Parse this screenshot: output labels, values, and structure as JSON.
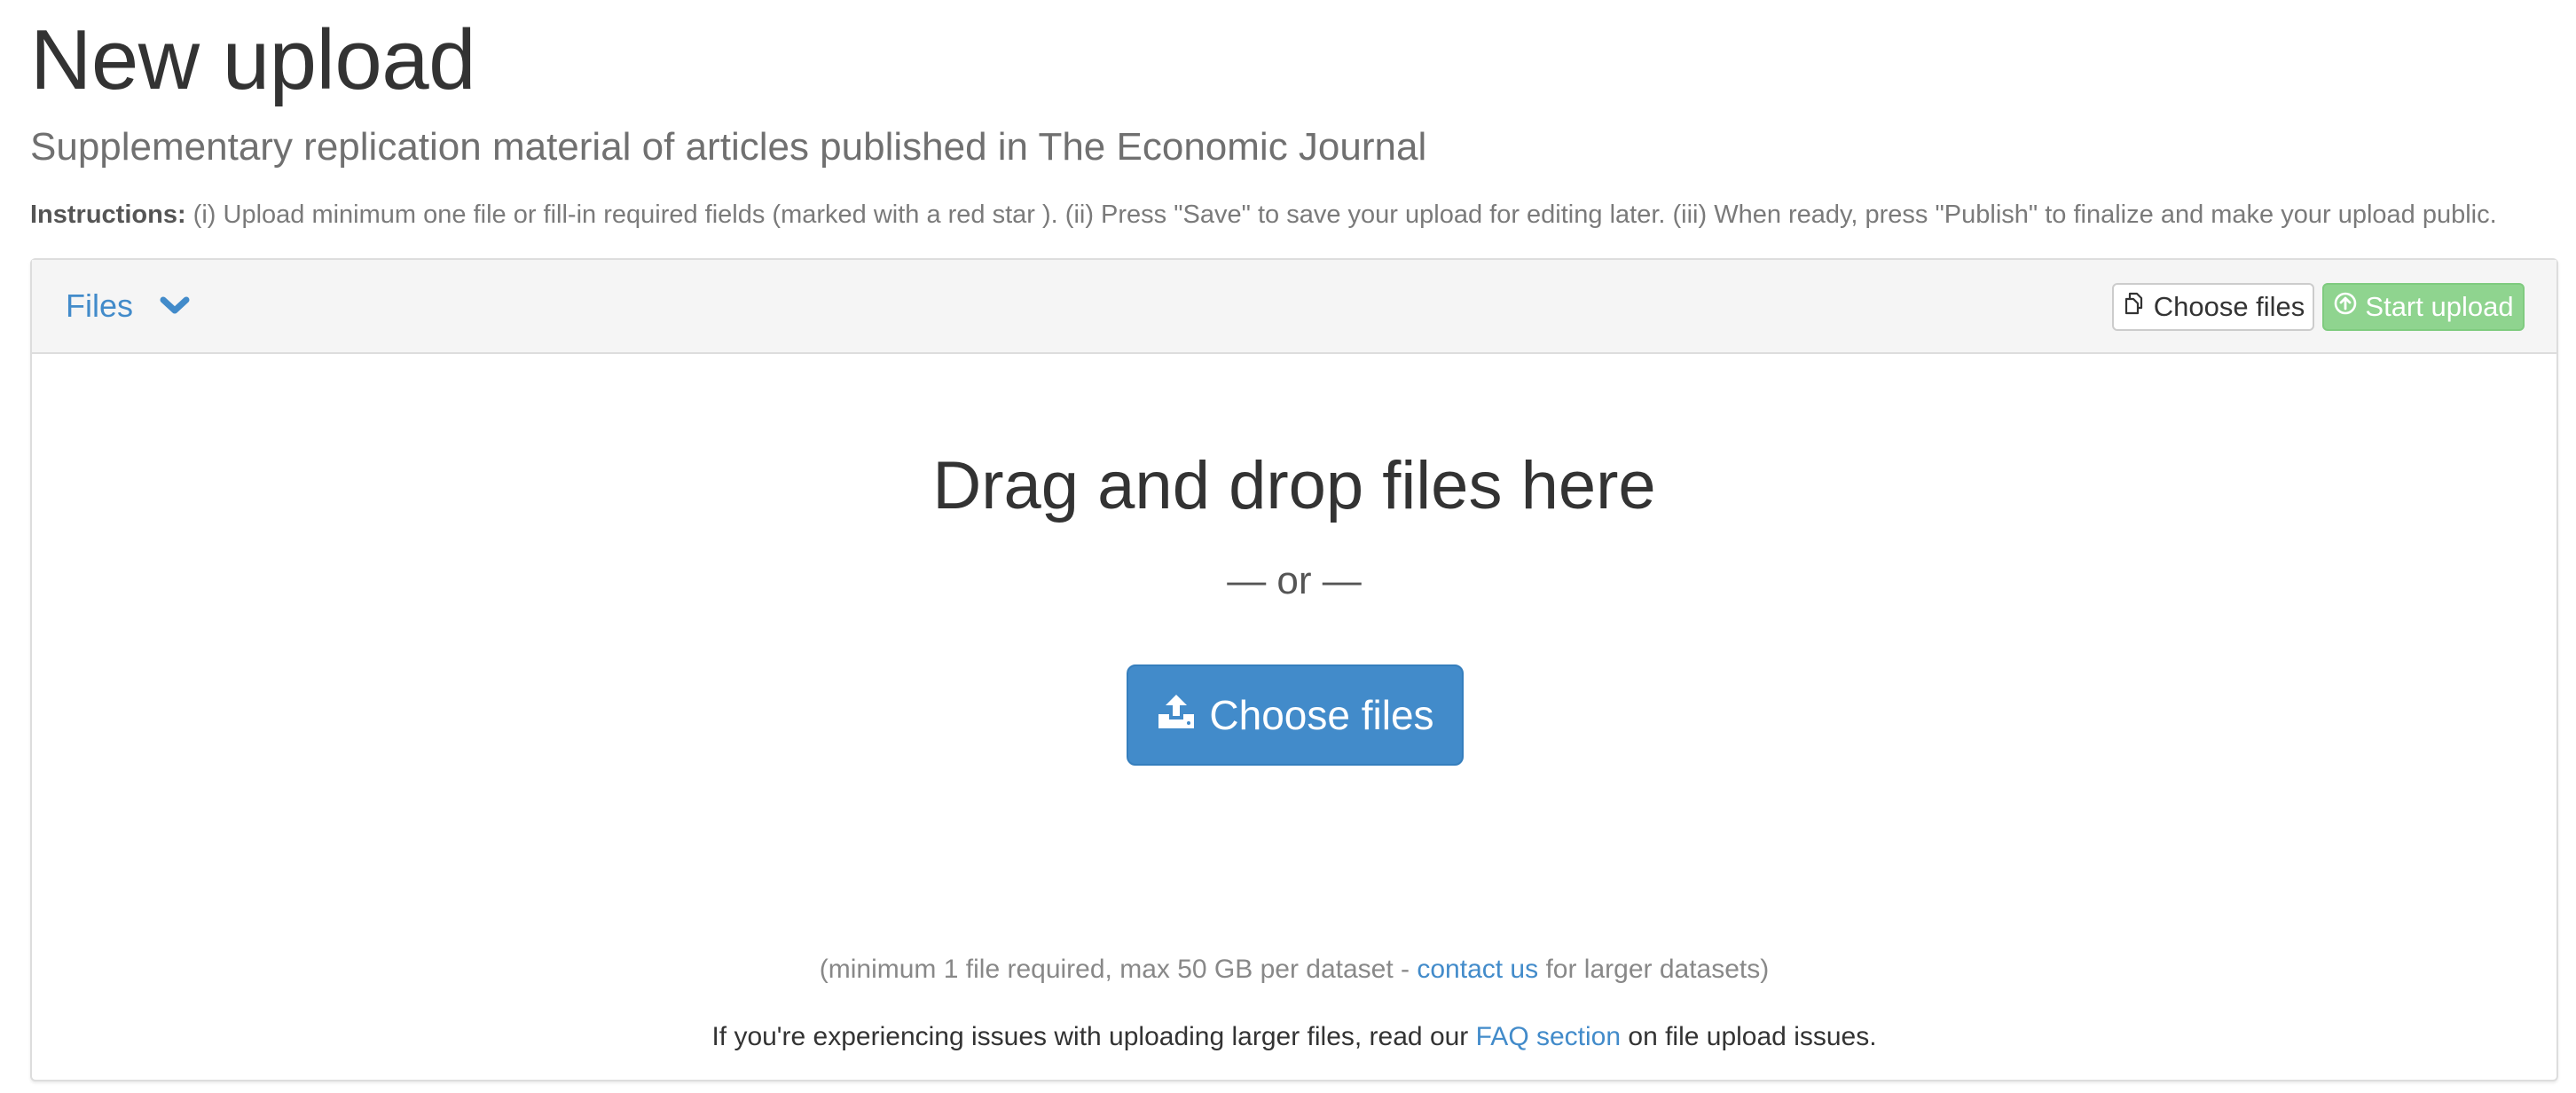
{
  "page": {
    "title": "New upload",
    "subtitle": "Supplementary replication material of articles published in The Economic Journal"
  },
  "instructions": {
    "label": "Instructions:",
    "text": " (i) Upload minimum one file or fill-in required fields (marked with a red star ). (ii) Press \"Save\" to save your upload for editing later. (iii) When ready, press \"Publish\" to finalize and make your upload public."
  },
  "files_panel": {
    "heading": "Files",
    "toggle_icon": "chevron-down-icon",
    "choose_files_label": "Choose files",
    "choose_files_icon": "copy-files-icon",
    "start_upload_label": "Start upload",
    "start_upload_icon": "circle-arrow-up-icon",
    "drop_title": "Drag and drop files here",
    "or_text": "— or —",
    "choose_button_label": "Choose files",
    "choose_button_icon": "upload-icon",
    "note_before": "(minimum 1 file required, max 50 GB per dataset - ",
    "note_link": "contact us",
    "note_after": " for larger datasets)",
    "issues_before": "If you're experiencing issues with uploading larger files, read our ",
    "issues_link": "FAQ section",
    "issues_after": " on file upload issues."
  },
  "colors": {
    "link": "#428bca",
    "primary_button": "#428bca",
    "success_button": "#8fd48f",
    "panel_heading_bg": "#f5f5f5"
  }
}
